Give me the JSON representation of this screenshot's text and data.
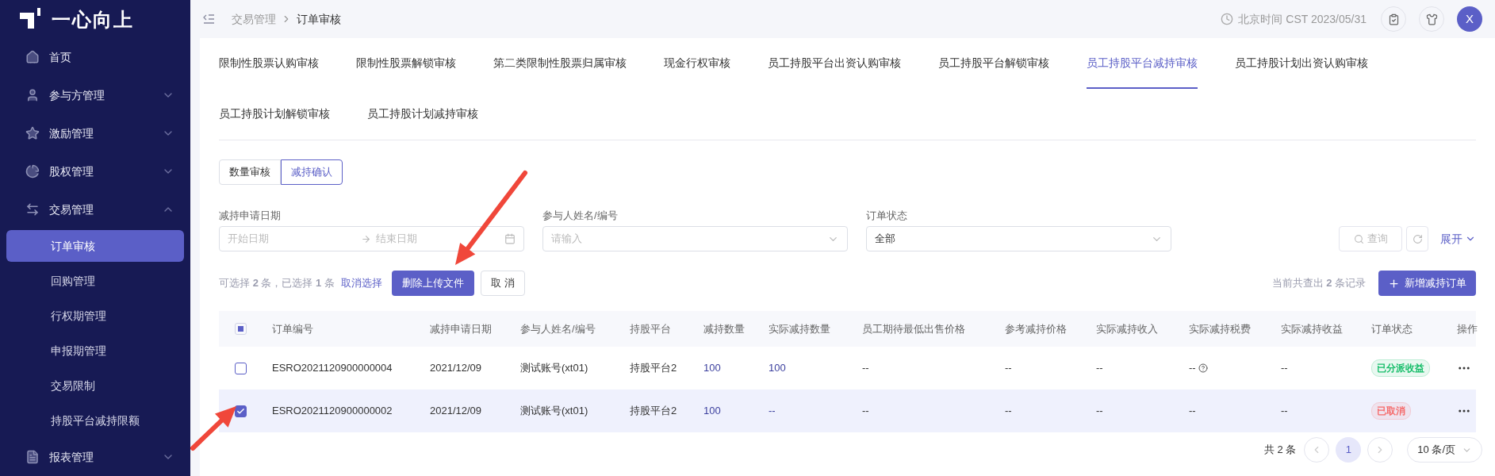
{
  "sidebar": {
    "logo": "一心向上",
    "items": [
      {
        "label": "首页",
        "kind": "link",
        "selected": false
      },
      {
        "label": "参与方管理",
        "kind": "group",
        "expanded": false,
        "selected": false
      },
      {
        "label": "激励管理",
        "kind": "group",
        "expanded": false,
        "selected": false
      },
      {
        "label": "股权管理",
        "kind": "group",
        "expanded": false,
        "selected": false
      },
      {
        "label": "交易管理",
        "kind": "group",
        "expanded": true,
        "selected": false,
        "children": [
          {
            "label": "订单审核",
            "selected": true
          },
          {
            "label": "回购管理",
            "selected": false
          },
          {
            "label": "行权期管理",
            "selected": false
          },
          {
            "label": "申报期管理",
            "selected": false
          },
          {
            "label": "交易限制",
            "selected": false
          },
          {
            "label": "持股平台减持限额",
            "selected": false
          }
        ]
      },
      {
        "label": "报表管理",
        "kind": "group",
        "expanded": false,
        "selected": false
      }
    ]
  },
  "header": {
    "breadcrumb": [
      "交易管理",
      "订单审核"
    ],
    "time": "北京时间 CST 2023/05/31",
    "avatar": "X"
  },
  "tabs": [
    {
      "label": "限制性股票认购审核",
      "selected": false
    },
    {
      "label": "限制性股票解锁审核",
      "selected": false
    },
    {
      "label": "第二类限制性股票归属审核",
      "selected": false
    },
    {
      "label": "现金行权审核",
      "selected": false
    },
    {
      "label": "员工持股平台出资认购审核",
      "selected": false
    },
    {
      "label": "员工持股平台解锁审核",
      "selected": false
    },
    {
      "label": "员工持股平台减持审核",
      "selected": true
    },
    {
      "label": "员工持股计划出资认购审核",
      "selected": false
    },
    {
      "label": "员工持股计划解锁审核",
      "selected": false
    },
    {
      "label": "员工持股计划减持审核",
      "selected": false
    }
  ],
  "subtabs": [
    {
      "label": "数量审核",
      "selected": false
    },
    {
      "label": "减持确认",
      "selected": true
    }
  ],
  "filters": [
    {
      "label": "减持申请日期",
      "kind": "daterange",
      "start_placeholder": "开始日期",
      "end_placeholder": "结束日期"
    },
    {
      "label": "参与人姓名/编号",
      "kind": "select",
      "placeholder": "请输入"
    },
    {
      "label": "订单状态",
      "kind": "select",
      "value": "全部"
    }
  ],
  "query_button": {
    "label": "查询",
    "disabled": true
  },
  "expand_link": "展开",
  "selection_info": "可选择 **2** 条，已选择 **1** 条",
  "cancel_selection": "取消选择",
  "delete_button": "删除上传文件",
  "cancel_button": "取 消",
  "record_count": "当前共查出 **2** 条记录",
  "add_button": "新增减持订单",
  "table": {
    "all_indeterminate": true,
    "columns": [
      "订单编号",
      "减持申请日期",
      "参与人姓名/编号",
      "持股平台",
      "减持数量",
      "实际减持数量",
      "员工期待最低出售价格",
      "参考减持价格",
      "实际减持收入",
      "实际减持税费",
      "实际减持收益",
      "订单状态",
      "操作"
    ],
    "rows": [
      {
        "selected": false,
        "cells": [
          "ESRO2021120900000004",
          "2021/12/09",
          "测试账号(xt01)",
          "持股平台2",
          "100",
          "100",
          "--",
          "--",
          "--",
          "--",
          "--"
        ],
        "tax_hint": true,
        "status": {
          "label": "已分派收益",
          "color": "#19be6b"
        }
      },
      {
        "selected": true,
        "cells": [
          "ESRO2021120900000002",
          "2021/12/09",
          "测试账号(xt01)",
          "持股平台2",
          "100",
          "--",
          "--",
          "--",
          "--",
          "--",
          "--"
        ],
        "tax_hint": false,
        "status": {
          "label": "已取消",
          "color": "#f56c6c"
        }
      }
    ]
  },
  "pagination": {
    "total": "共 2 条",
    "pages": [
      {
        "label": "1",
        "selected": true
      }
    ],
    "page_size": "10 条/页"
  }
}
